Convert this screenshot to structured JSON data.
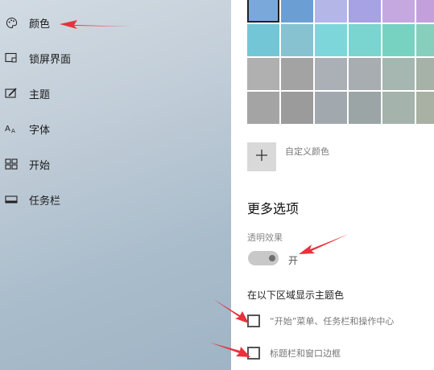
{
  "sidebar": {
    "items": [
      {
        "label": "颜色",
        "icon": "palette-icon"
      },
      {
        "label": "锁屏界面",
        "icon": "lock-screen-icon"
      },
      {
        "label": "主题",
        "icon": "theme-brush-icon"
      },
      {
        "label": "字体",
        "icon": "font-icon"
      },
      {
        "label": "开始",
        "icon": "start-menu-icon"
      },
      {
        "label": "任务栏",
        "icon": "taskbar-icon"
      }
    ]
  },
  "colors": {
    "swatches": [
      "#7aa8da",
      "#6b9fd4",
      "#b3b6e6",
      "#a7a2e4",
      "#c5a8e0",
      "#c3a0dc",
      "#73c6d6",
      "#86c2d0",
      "#7dd7da",
      "#7ad4cf",
      "#78d2c2",
      "#86cfbd",
      "#b0b0b0",
      "#a3a3a3",
      "#abb0b6",
      "#a7adb1",
      "#a6b6b1",
      "#a6b2a8",
      "#a4a4a4",
      "#9b9b9b",
      "#a2a9ae",
      "#9ba5a6",
      "#a4b3ac",
      "#a8b1a4"
    ],
    "selected_index": 0,
    "custom_label": "自定义颜色",
    "accent": "#e8323b"
  },
  "more_options": {
    "title": "更多选项",
    "transparency_label": "透明效果",
    "transparency_state": "开",
    "accent_surfaces_title": "在以下区域显示主题色",
    "checkboxes": [
      {
        "label": "“开始”菜单、任务栏和操作中心",
        "checked": false
      },
      {
        "label": "标题栏和窗口边框",
        "checked": false
      }
    ]
  }
}
